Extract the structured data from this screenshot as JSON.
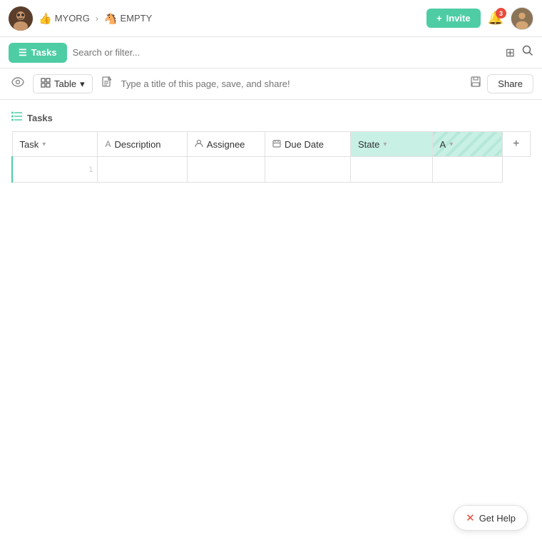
{
  "navbar": {
    "org_icon": "👍",
    "org_name": "MYORG",
    "chevron": "›",
    "workspace_icon": "🐴",
    "workspace_name": "EMPTY",
    "invite_label": "Invite",
    "invite_icon": "+",
    "notif_count": "3",
    "bell_icon": "🔔"
  },
  "toolbar": {
    "tasks_icon": "☰",
    "tasks_label": "Tasks",
    "search_placeholder": "Search or filter...",
    "grid_icon": "⊞",
    "search_icon": "🔍"
  },
  "view_toolbar": {
    "eye_icon": "👁",
    "table_icon": "⊞",
    "table_label": "Table",
    "chevron_down": "▾",
    "doc_icon": "📄",
    "title_placeholder": "Type a title of this page, save, and share!",
    "save_icon": "💾",
    "share_label": "Share"
  },
  "section": {
    "icon": "☰",
    "title": "Tasks"
  },
  "table": {
    "columns": [
      {
        "id": "task",
        "label": "Task",
        "icon": "▾",
        "type": "text"
      },
      {
        "id": "description",
        "label": "Description",
        "icon": "A",
        "type": "text"
      },
      {
        "id": "assignee",
        "label": "Assignee",
        "icon": "👤",
        "type": "person"
      },
      {
        "id": "due_date",
        "label": "Due Date",
        "icon": "📅",
        "type": "date"
      },
      {
        "id": "state",
        "label": "State",
        "icon": "▾",
        "type": "status",
        "highlighted": true
      },
      {
        "id": "extra",
        "label": "A",
        "icon": "▾",
        "type": "custom",
        "striped": true
      }
    ],
    "add_col_icon": "+",
    "rows": [
      {
        "num": "1",
        "task": "",
        "description": "",
        "assignee": "",
        "due_date": "",
        "state": "",
        "extra": ""
      }
    ]
  },
  "help": {
    "icon": "✕",
    "label": "Get Help"
  }
}
